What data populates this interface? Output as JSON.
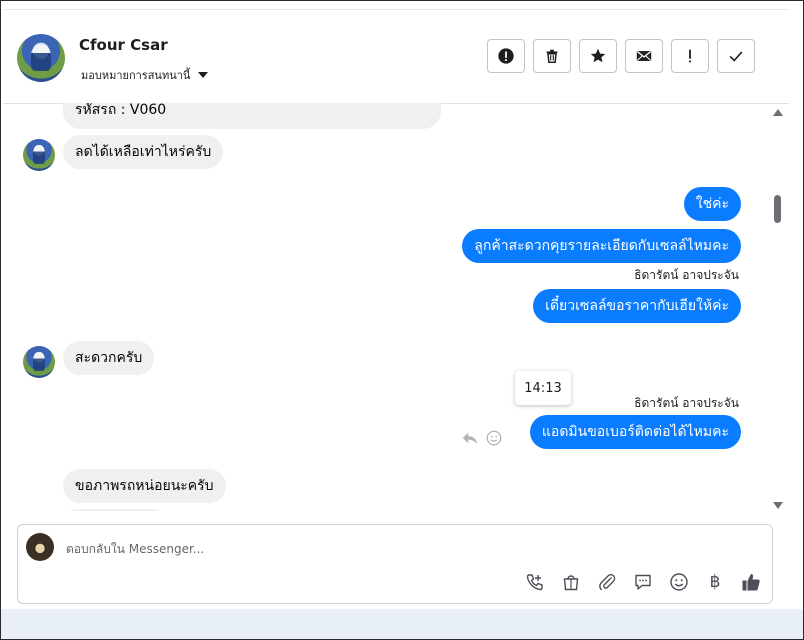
{
  "header": {
    "contact_name": "Cfour Csar",
    "assign_label": "มอบหมายการสนทนานี้",
    "actions": [
      "mark-spam-icon",
      "delete-icon",
      "star-icon",
      "email-icon",
      "follow-up-icon",
      "done-icon"
    ]
  },
  "messages": {
    "partial_incoming": "รหัสรถ : V060",
    "m1": "ลดได้เหลือเท่าไหร่ครับ",
    "m2": "ใช่ค่ะ",
    "m3": "ลูกค้าสะดวกคุยรายละเอียดกับเซลล์ไหมคะ",
    "sender_1": "ธิดารัตน์ อาจประจัน",
    "m4": "เดี๋ยวเซลล์ขอราคากับเฮียให้ค่ะ",
    "m5": "สะดวกครับ",
    "timestamp_tooltip": "14:13",
    "sender_2": "ธิดารัตน์ อาจประจัน",
    "m6": "แอดมินขอเบอร์ติดต่อได้ไหมคะ",
    "m7": "ขอภาพรถหน่อยนะครับ"
  },
  "composer": {
    "placeholder": "ตอบกลับใน Messenger...",
    "tools": [
      "call-icon",
      "shopping-bag-icon",
      "attachment-icon",
      "saved-reply-icon",
      "emoji-icon",
      "baht-icon",
      "like-icon"
    ],
    "baht_symbol": "฿"
  },
  "colors": {
    "outgoing_bubble": "#0a7cff",
    "incoming_bubble": "#f0f0f0"
  }
}
